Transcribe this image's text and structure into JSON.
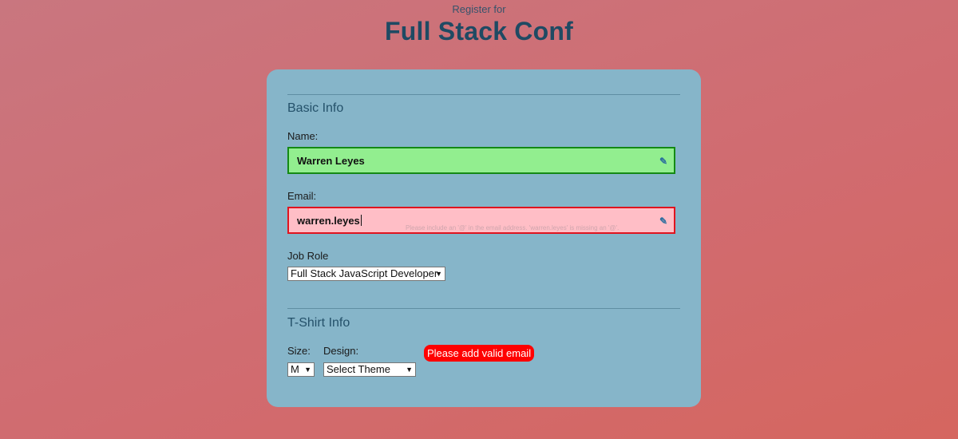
{
  "header": {
    "subtitle": "Register for",
    "title": "Full Stack Conf"
  },
  "basic_info": {
    "section_title": "Basic Info",
    "name_label": "Name:",
    "name_value": "Warren Leyes",
    "email_label": "Email:",
    "email_value": "warren.leyes",
    "email_hint": "Please include an '@' in the email address. 'warren.leyes' is missing an '@'.",
    "job_role_label": "Job Role",
    "job_role_selected": "Full Stack JavaScript Developer"
  },
  "tshirt_info": {
    "section_title": "T-Shirt Info",
    "size_label": "Size:",
    "size_selected": "M",
    "design_label": "Design:",
    "design_selected": "Select Theme"
  },
  "error_message": "Please add valid email",
  "icons": {
    "field_edit": "pen-icon",
    "select_arrow": "▼"
  },
  "colors": {
    "name_valid_bg": "#92ee8f",
    "name_valid_border": "#148a14",
    "email_invalid_bg": "#ffbec6",
    "email_invalid_border": "#e0141f",
    "error_pill": "#ff0000",
    "card_bg": "#86b5c9"
  }
}
